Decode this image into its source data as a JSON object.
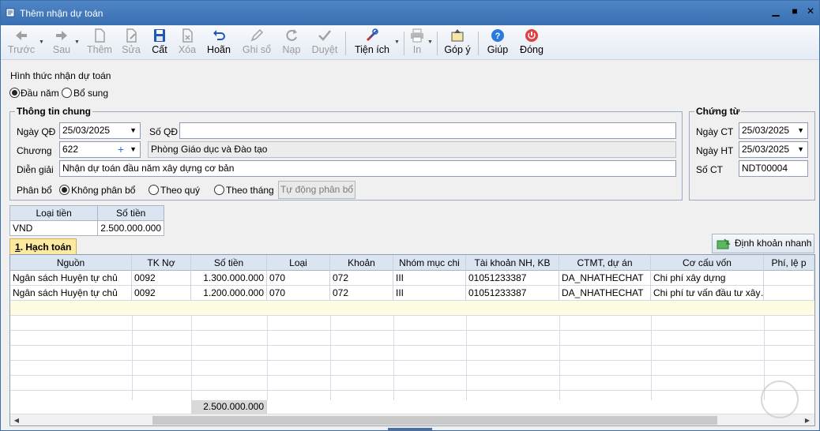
{
  "window": {
    "title": "Thêm nhận dự toán",
    "minimize": "▁",
    "maximize": "■",
    "close": "✕"
  },
  "toolbar": {
    "prev": "Trước",
    "next": "Sau",
    "add": "Thêm",
    "edit": "Sửa",
    "save": "Cất",
    "delete": "Xóa",
    "undo": "Hoãn",
    "post": "Ghi sổ",
    "reload": "Nạp",
    "approve": "Duyệt",
    "utilities": "Tiện ích",
    "print": "In",
    "feedback": "Góp ý",
    "help": "Giúp",
    "close": "Đóng"
  },
  "form": {
    "receive_type_label": "Hình thức nhận dự toán",
    "receive_type_options": [
      "Đầu năm",
      "Bổ sung"
    ],
    "receive_type_selected": "Đầu năm",
    "general": {
      "title": "Thông tin chung",
      "date_label": "Ngày QĐ",
      "date_value": "25/03/2025",
      "decision_no_label": "Số QĐ",
      "decision_no_value": "",
      "chapter_label": "Chương",
      "chapter_value": "622",
      "chapter_name": "Phòng Giáo dục và Đào tạo",
      "description_label": "Diễn giải",
      "description_value": "Nhận dự toán đầu năm xây dựng cơ bản",
      "allocation_label": "Phân bổ",
      "allocation_options": [
        "Không phân bổ",
        "Theo quý",
        "Theo tháng"
      ],
      "allocation_selected": "Không phân bổ",
      "auto_allocate_button": "Tự động phân bổ"
    },
    "voucher": {
      "title": "Chứng từ",
      "voucher_date_label": "Ngày CT",
      "voucher_date_value": "25/03/2025",
      "posting_date_label": "Ngày HT",
      "posting_date_value": "25/03/2025",
      "voucher_no_label": "Số CT",
      "voucher_no_value": "NDT00004"
    }
  },
  "currency_table": {
    "headers": [
      "Loại tiền",
      "Số tiền"
    ],
    "rows": [
      [
        "VND",
        "2.500.000.000"
      ]
    ]
  },
  "tabs": {
    "accounting_num": "1",
    "accounting_label": ". Hạch toán"
  },
  "quick_entry_button": "Định khoản nhanh",
  "grid": {
    "columns": [
      "Nguồn",
      "TK Nợ",
      "Số tiền",
      "Loại",
      "Khoản",
      "Nhóm mục chi",
      "Tài khoản NH, KB",
      "CTMT, dự án",
      "Cơ cấu vốn",
      "Phí, lệ p"
    ],
    "rows": [
      [
        "Ngân sách Huyện tự chủ",
        "0092",
        "1.300.000.000",
        "070",
        "072",
        "III",
        "01051233387",
        "DA_NHATHECHAT",
        "Chi phí xây dựng",
        ""
      ],
      [
        "Ngân sách Huyện tự chủ",
        "0092",
        "1.200.000.000",
        "070",
        "072",
        "III",
        "01051233387",
        "DA_NHATHECHAT",
        "Chi phí tư vấn đầu tư xây…",
        ""
      ]
    ],
    "total": "2.500.000.000"
  },
  "colors": {
    "titlebar": "#3a6fb1",
    "tab": "#fde9a0",
    "edit_row": "#fdfce0"
  }
}
